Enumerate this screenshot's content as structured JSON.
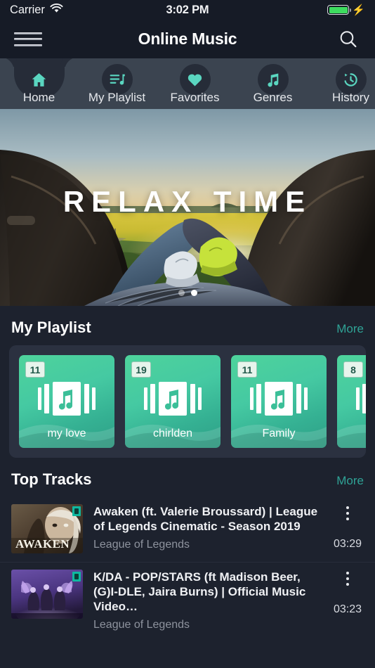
{
  "status_bar": {
    "carrier": "Carrier",
    "wifi_icon": "wifi-icon",
    "time": "3:02 PM",
    "battery_icon": "battery-full-icon",
    "charging_icon": "lightning-bolt-icon"
  },
  "header": {
    "menu_icon": "hamburger-menu-icon",
    "title": "Online Music",
    "search_icon": "search-icon"
  },
  "tabs": [
    {
      "label": "Home",
      "icon": "home-icon",
      "active": true
    },
    {
      "label": "My Playlist",
      "icon": "queue-music-icon",
      "active": false
    },
    {
      "label": "Favorites",
      "icon": "heart-icon",
      "active": false
    },
    {
      "label": "Genres",
      "icon": "music-note-icon",
      "active": false
    },
    {
      "label": "History",
      "icon": "history-clock-icon",
      "active": false
    }
  ],
  "banner": {
    "title": "RELAX TIME",
    "image_description": "two people reclining in a car trunk facing a yellow rapeseed field at sunset",
    "dots": 2,
    "active_dot": 1
  },
  "playlist_section": {
    "title": "My Playlist",
    "more_label": "More",
    "cards": [
      {
        "name": "my love",
        "count": "11",
        "icon": "library-music-icon"
      },
      {
        "name": "chirlden",
        "count": "19",
        "icon": "library-music-icon"
      },
      {
        "name": "Family",
        "count": "11",
        "icon": "library-music-icon"
      },
      {
        "name": "",
        "count": "8",
        "icon": "library-music-icon"
      }
    ]
  },
  "top_tracks_section": {
    "title": "Top Tracks",
    "more_label": "More",
    "tracks": [
      {
        "title": "Awaken (ft. Valerie Broussard) | League of Legends Cinematic - Season 2019",
        "artist": "League of Legends",
        "duration": "03:29",
        "menu_icon": "more-vertical-icon",
        "thumbnail_description": "AWAKEN cinematic key art, sepia tones, white-haired character"
      },
      {
        "title": "K/DA - POP/STARS (ft Madison Beer, (G)I-DLE, Jaira Burns) | Official Music Video…",
        "artist": "League of Legends",
        "duration": "03:23",
        "menu_icon": "more-vertical-icon",
        "thumbnail_description": "K/DA POP/STARS music video still, purple stage lighting with four figures"
      }
    ]
  },
  "colors": {
    "page_background": "#1d222e",
    "header_background": "#161b26",
    "tabbar_background": "#3b4450",
    "tab_active_background": "#262c38",
    "accent_teal": "#5ad6c0",
    "link_teal": "#2fa396",
    "card_green": "#45c9a2",
    "battery_green": "#3ddc5f"
  }
}
